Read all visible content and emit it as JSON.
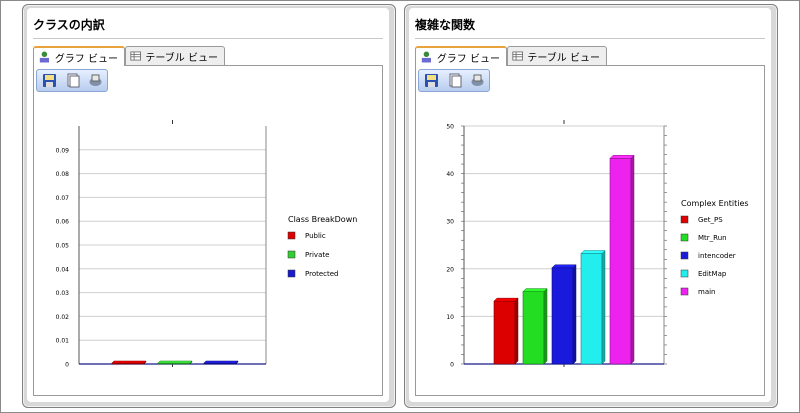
{
  "left_panel": {
    "title": "クラスの内訳",
    "tabs": [
      {
        "label": "グラフ ビュー",
        "active": true
      },
      {
        "label": "テーブル ビュー",
        "active": false
      }
    ],
    "toolbar": [
      {
        "icon": "save-icon"
      },
      {
        "icon": "copy-icon"
      },
      {
        "icon": "print-icon"
      }
    ]
  },
  "right_panel": {
    "title": "複雑な関数",
    "tabs": [
      {
        "label": "グラフ ビュー",
        "active": true
      },
      {
        "label": "テーブル ビュー",
        "active": false
      }
    ],
    "toolbar": [
      {
        "icon": "save-icon"
      },
      {
        "icon": "copy-icon"
      },
      {
        "icon": "print-icon"
      }
    ]
  },
  "chart_data": [
    {
      "type": "bar",
      "legend_title": "Class BreakDown",
      "categories": [
        "Public",
        "Private",
        "Protected"
      ],
      "values": [
        0,
        0,
        0
      ],
      "colors": [
        "#dd0000",
        "#33cc33",
        "#1a1acc"
      ],
      "ylim": [
        0,
        0.1
      ],
      "yticks": [
        "0",
        "0.01",
        "0.02",
        "0.03",
        "0.04",
        "0.05",
        "0.06",
        "0.07",
        "0.08",
        "0.09"
      ],
      "grid": true,
      "legend_position": "right"
    },
    {
      "type": "bar",
      "legend_title": "Complex Entities",
      "categories": [
        "Get_PS",
        "Mtr_Run",
        "intencoder",
        "EditMap",
        "main"
      ],
      "values": [
        13,
        15,
        20,
        23,
        43
      ],
      "colors": [
        "#dd0000",
        "#22dd22",
        "#1a1add",
        "#22eeee",
        "#ee22ee"
      ],
      "ylim": [
        0,
        50
      ],
      "yticks": [
        "0",
        "10",
        "20",
        "30",
        "40",
        "50"
      ],
      "grid": true,
      "legend_position": "right"
    }
  ]
}
